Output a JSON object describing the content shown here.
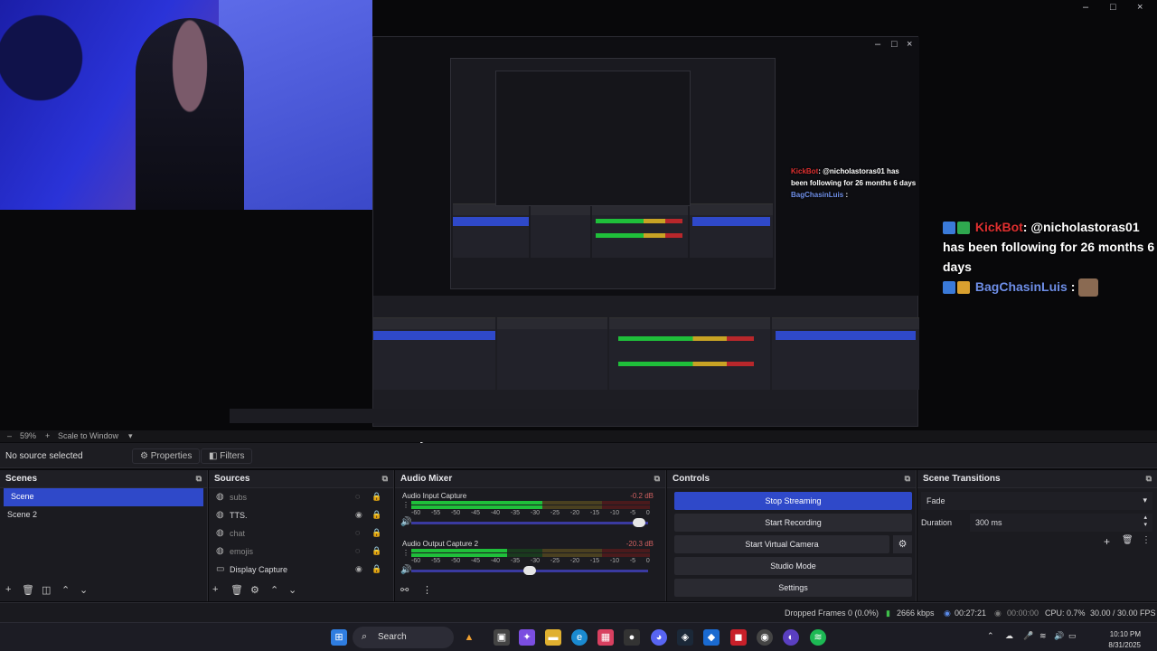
{
  "preview": {
    "chat_large": {
      "user1": "KickBot",
      "message": ": @nicholastoras01 has been following for 26 months 6 days",
      "user2": "BagChasinLuis",
      "colon": ":"
    },
    "chat_small": {
      "user1": "KickBot",
      "message": ": @nicholastoras01 has been following for 26 months 6 days",
      "user2": "BagChasinLuis",
      "colon": ":"
    }
  },
  "zoom": {
    "percent": "59%",
    "scale_label": "Scale to Window"
  },
  "source_toolbar": {
    "no_source": "No source selected",
    "properties": "Properties",
    "filters": "Filters"
  },
  "scenes": {
    "title": "Scenes",
    "items": [
      "Scene",
      "Scene 2"
    ]
  },
  "sources": {
    "title": "Sources",
    "items": [
      "subs",
      "TTS.",
      "chat",
      "emojis",
      "Display Capture"
    ]
  },
  "mixer": {
    "title": "Audio Mixer",
    "channels": [
      {
        "name": "Audio Input Capture",
        "db": "-0.2 dB",
        "level": 0.55,
        "volume": 0.96
      },
      {
        "name": "Audio Output Capture 2",
        "db": "-20.3 dB",
        "level": 0.4,
        "volume": 0.5
      }
    ],
    "scale": [
      "-60",
      "-55",
      "-50",
      "-45",
      "-40",
      "-35",
      "-30",
      "-25",
      "-20",
      "-15",
      "-10",
      "-5",
      "0"
    ]
  },
  "controls": {
    "title": "Controls",
    "stop_streaming": "Stop Streaming",
    "start_recording": "Start Recording",
    "start_virtual_camera": "Start Virtual Camera",
    "studio_mode": "Studio Mode",
    "settings": "Settings"
  },
  "transitions": {
    "title": "Scene Transitions",
    "selected": "Fade",
    "duration_label": "Duration",
    "duration_value": "300 ms"
  },
  "status": {
    "dropped": "Dropped Frames 0 (0.0%)",
    "bitrate": "2666 kbps",
    "stream_time": "00:27:21",
    "rec_time": "00:00:00",
    "cpu": "CPU: 0.7%",
    "fps": "30.00 / 30.00 FPS"
  },
  "taskbar": {
    "search": "Search",
    "time": "10:10 PM",
    "date": "8/31/2025"
  },
  "colors": {
    "accent": "#2f49c9",
    "kick": "#e03030",
    "bag": "#6f8fe8"
  }
}
